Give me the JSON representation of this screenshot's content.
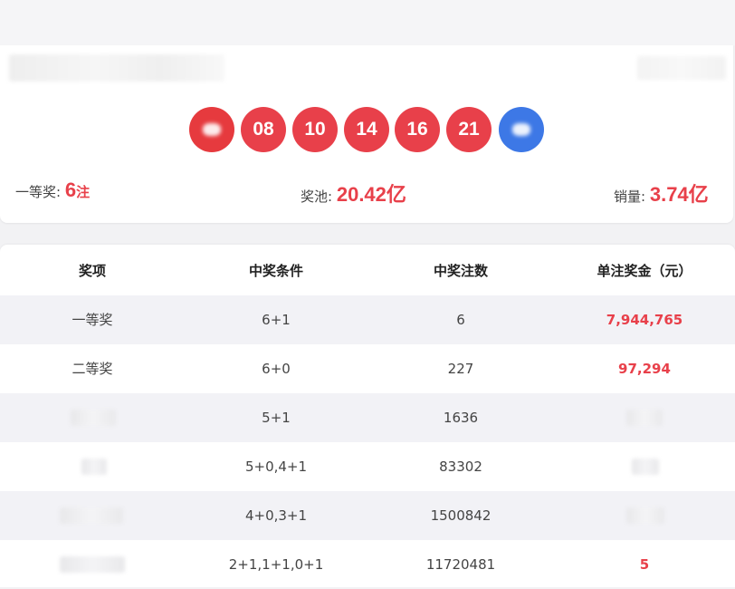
{
  "draw": {
    "balls": [
      "",
      "08",
      "10",
      "14",
      "16",
      "21",
      ""
    ],
    "stats": {
      "first_label": "一等奖:",
      "first_value": "6",
      "first_unit": "注",
      "pool_label": "奖池:",
      "pool_value": "20.42亿",
      "sales_label": "销量:",
      "sales_value": "3.74亿"
    }
  },
  "table": {
    "headers": [
      "奖项",
      "中奖条件",
      "中奖注数",
      "单注奖金（元）"
    ],
    "rows": [
      {
        "level": "一等奖",
        "condition": "6+1",
        "count": "6",
        "prize": "7,944,765"
      },
      {
        "level": "二等奖",
        "condition": "6+0",
        "count": "227",
        "prize": "97,294"
      },
      {
        "level": "",
        "condition": "5+1",
        "count": "1636",
        "prize": ""
      },
      {
        "level": "",
        "condition": "5+0,4+1",
        "count": "83302",
        "prize": ""
      },
      {
        "level": "",
        "condition": "4+0,3+1",
        "count": "1500842",
        "prize": ""
      },
      {
        "level": "",
        "condition": "2+1,1+1,0+1",
        "count": "11720481",
        "prize": "5"
      }
    ]
  },
  "colors": {
    "accent_red": "#e8404a",
    "blue_ball": "#3d78e6",
    "row_alt": "#f2f2f6"
  }
}
